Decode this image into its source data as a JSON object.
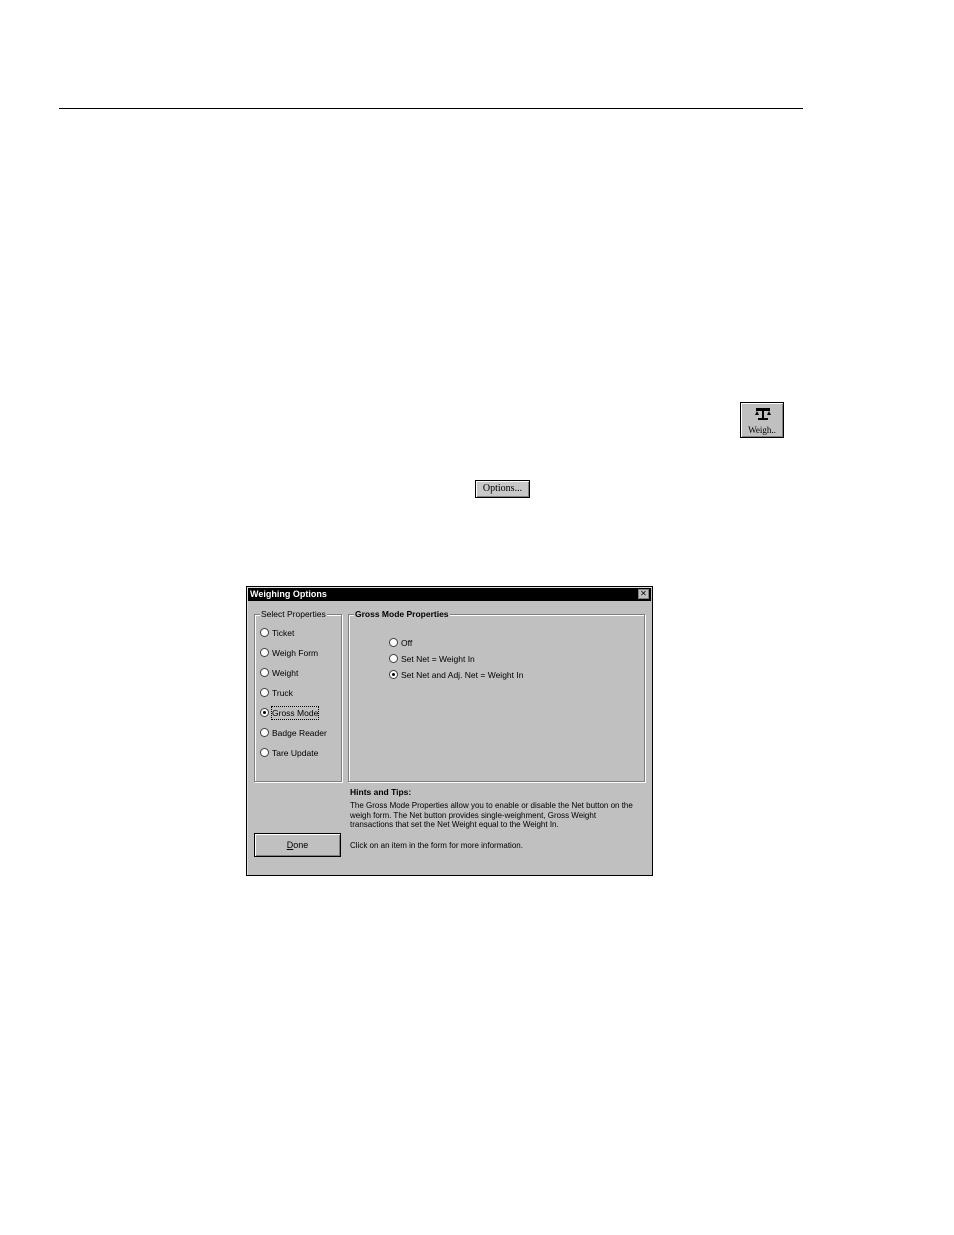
{
  "toolbar": {
    "weigh_label": "Weigh..",
    "weigh_icon": "scale-icon"
  },
  "options_button": {
    "label": "Options..."
  },
  "dialog": {
    "title": "Weighing Options",
    "close_icon": "close-icon",
    "select_properties": {
      "label": "Select Properties",
      "items": [
        {
          "label": "Ticket",
          "selected": false
        },
        {
          "label": "Weigh Form",
          "selected": false
        },
        {
          "label": "Weight",
          "selected": false
        },
        {
          "label": "Truck",
          "selected": false
        },
        {
          "label": "Gross Mode",
          "selected": true
        },
        {
          "label": "Badge Reader",
          "selected": false
        },
        {
          "label": "Tare Update",
          "selected": false
        }
      ]
    },
    "gross_mode": {
      "label": "Gross Mode Properties",
      "options": [
        {
          "label": "Off",
          "selected": false
        },
        {
          "label": "Set Net = Weight In",
          "selected": false
        },
        {
          "label": "Set Net and Adj. Net = Weight In",
          "selected": true
        }
      ]
    },
    "hints": {
      "title": "Hints and Tips:",
      "body": "The Gross Mode Properties allow you to enable or disable the Net button on the weigh form.  The Net button provides single-weighment, Gross Weight transactions that set the Net Weight equal to the Weight In.",
      "click_info": "Click on an item in the form for more information."
    },
    "done_button": {
      "underlined_letter": "D",
      "rest": "one"
    }
  }
}
